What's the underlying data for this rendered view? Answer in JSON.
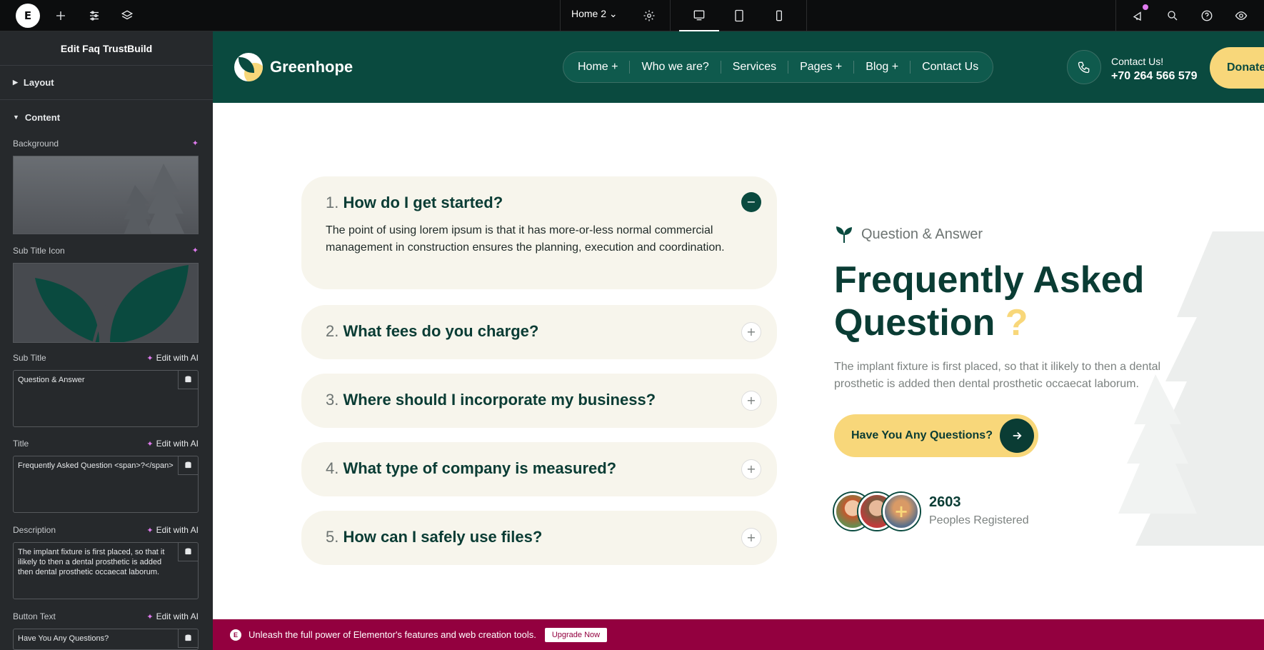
{
  "topbar": {
    "page_name": "Home 2",
    "icons": [
      "elementor-logo-icon",
      "add-icon",
      "sliders-icon",
      "layers-icon",
      "settings-icon",
      "desktop-icon",
      "tablet-icon",
      "mobile-icon",
      "notifications-icon",
      "search-icon",
      "help-icon",
      "preview-icon"
    ]
  },
  "panel": {
    "title": "Edit Faq TrustBuild",
    "sections": {
      "layout": "Layout",
      "content": "Content"
    },
    "background_label": "Background",
    "subtitle_icon_label": "Sub Title Icon",
    "subtitle_label": "Sub Title",
    "subtitle_value": "Question & Answer",
    "title_label": "Title",
    "title_value": "Frequently Asked Question <span>?</span>",
    "description_label": "Description",
    "description_value": "The implant fixture is first placed, so that it ilikely to then a dental prosthetic is added then dental prosthetic occaecat laborum.",
    "button_text_label": "Button Text",
    "button_text_value": "Have You Any Questions?",
    "edit_ai": "Edit with AI"
  },
  "site": {
    "brand": "Greenhope",
    "nav": [
      "Home +",
      "Who we are?",
      "Services",
      "Pages +",
      "Blog +",
      "Contact Us"
    ],
    "contact_label": "Contact Us!",
    "contact_number": "+70 264 566 579",
    "donate": "Donate"
  },
  "faq": [
    {
      "num": "1.",
      "question": "How do I get started?",
      "answer": "The point of using lorem ipsum is that it has more-or-less normal commercial management in construction ensures the planning, execution and coordination.",
      "open": true,
      "icon": "−"
    },
    {
      "num": "2.",
      "question": "What fees do you charge?",
      "open": false,
      "icon": "+"
    },
    {
      "num": "3.",
      "question": "Where should I incorporate my business?",
      "open": false,
      "icon": "+"
    },
    {
      "num": "4.",
      "question": "What type of company is measured?",
      "open": false,
      "icon": "+"
    },
    {
      "num": "5.",
      "question": "How can I safely use files?",
      "open": false,
      "icon": "+"
    }
  ],
  "hero": {
    "subtitle": "Question & Answer",
    "title_main": "Frequently Asked Question",
    "title_mark": "?",
    "description": "The implant fixture is first placed, so that it ilikely to then a dental prosthetic is added then dental prosthetic occaecat laborum.",
    "cta": "Have You Any Questions?",
    "count": "2603",
    "count_label": "Peoples Registered",
    "avatar_more": "+"
  },
  "promo": {
    "text": "Unleash the full power of Elementor's features and web creation tools.",
    "button": "Upgrade Now"
  },
  "colors": {
    "brand_green": "#0a4a3f",
    "accent_yellow": "#f8d77a",
    "promo": "#93003f"
  }
}
